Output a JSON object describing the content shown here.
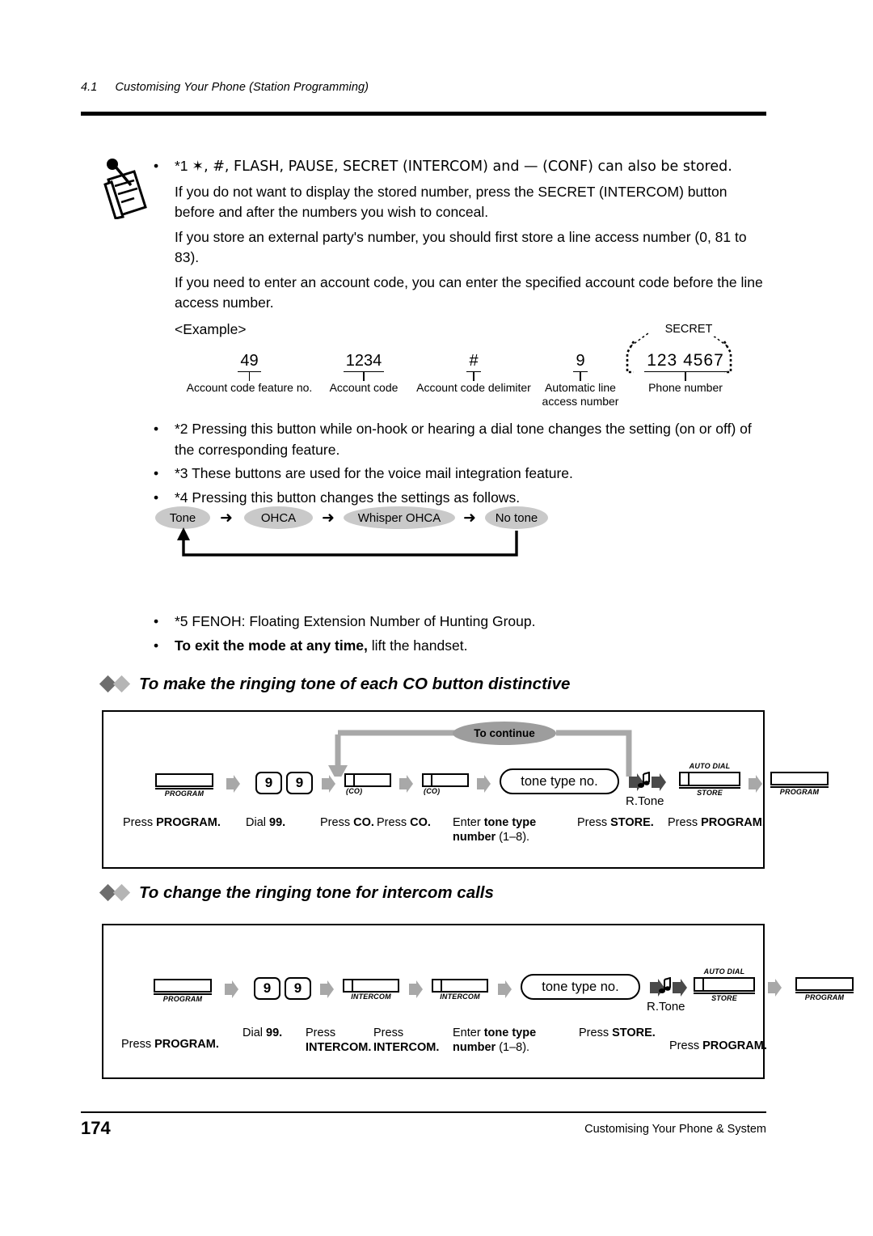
{
  "header": {
    "section_number": "4.1",
    "section_title": "Customising Your Phone (Station Programming)"
  },
  "notes": {
    "icon_name": "notepad-pen-icon",
    "bullet1": {
      "prefix": "*1",
      "text": "✶, #, FLASH, PAUSE, SECRET (INTERCOM) and — (CONF) can also be stored."
    },
    "para1": "If you do not want to display the stored number, press the SECRET (INTERCOM) button before and after the numbers you wish to conceal.",
    "para2": "If you store an external party's number, you should first store a line access number (0, 81 to 83).",
    "para3": "If you need to enter an account code, you can enter the specified account code before the line access number.",
    "example_label": "<Example>",
    "bullet2": "*2 Pressing this button while on-hook or hearing a dial tone changes the setting (on or off) of the corresponding feature.",
    "bullet3": "*3 These buttons are used for the voice mail integration feature.",
    "bullet4": "*4 Pressing this button changes the settings as follows.",
    "bullet5": "*5 FENOH: Floating Extension Number of Hunting Group.",
    "bullet6_bold": "To exit the mode at any time,",
    "bullet6_rest": " lift the handset."
  },
  "example_diagram": {
    "secret_label": "SECRET",
    "items": [
      {
        "value": "49",
        "caption": "Account code feature no."
      },
      {
        "value": "1234",
        "caption": "Account code"
      },
      {
        "value": "#",
        "caption": "Account code delimiter"
      },
      {
        "value": "9",
        "caption": "Automatic line access number"
      },
      {
        "value": "123  4567",
        "caption": "Phone number"
      }
    ]
  },
  "tone_flow": {
    "states": [
      "Tone",
      "OHCA",
      "Whisper OHCA",
      "No tone"
    ],
    "arrow": "➜",
    "loops_back_to": "Tone"
  },
  "sections": [
    {
      "heading": "To make the ringing tone of each CO button distinctive",
      "continue_label": "To continue",
      "rtone_label": "R.Tone",
      "steps": [
        {
          "key_type": "program",
          "key_label": "PROGRAM",
          "caption_plain": "Press ",
          "caption_bold": "PROGRAM.",
          "caption_tail": ""
        },
        {
          "key_type": "digits",
          "digits": [
            "9",
            "9"
          ],
          "caption_plain": "Dial ",
          "caption_bold": "99.",
          "caption_tail": ""
        },
        {
          "key_type": "co",
          "key_label": "(CO)",
          "caption_plain": "Press ",
          "caption_bold": "CO.",
          "caption_tail": ""
        },
        {
          "key_type": "co",
          "key_label": "(CO)",
          "caption_plain": "Press ",
          "caption_bold": "CO.",
          "caption_tail": ""
        },
        {
          "key_type": "pill",
          "key_label": "tone type no.",
          "caption_plain": "Enter ",
          "caption_bold": "tone type number",
          "caption_tail": " (1–8)."
        },
        {
          "key_type": "tone",
          "key_label": "R.Tone",
          "caption_plain": "",
          "caption_bold": "",
          "caption_tail": ""
        },
        {
          "key_type": "autodial",
          "key_label_above": "AUTO DIAL",
          "key_label_below": "STORE",
          "caption_plain": "Press ",
          "caption_bold": "STORE.",
          "caption_tail": ""
        },
        {
          "key_type": "program",
          "key_label": "PROGRAM",
          "caption_plain": "Press ",
          "caption_bold": "PROGRAM.",
          "caption_tail": ""
        }
      ]
    },
    {
      "heading": "To change the ringing tone for intercom calls",
      "continue_label": "",
      "rtone_label": "R.Tone",
      "steps": [
        {
          "key_type": "program",
          "key_label": "PROGRAM",
          "caption_plain": "Press ",
          "caption_bold": "PROGRAM.",
          "caption_tail": ""
        },
        {
          "key_type": "digits",
          "digits": [
            "9",
            "9"
          ],
          "caption_plain": "Dial ",
          "caption_bold": "99.",
          "caption_tail": ""
        },
        {
          "key_type": "intercom",
          "key_label": "INTERCOM",
          "caption_plain": "Press ",
          "caption_bold": "INTERCOM.",
          "caption_tail": ""
        },
        {
          "key_type": "intercom",
          "key_label": "INTERCOM",
          "caption_plain": "Press ",
          "caption_bold": "INTERCOM.",
          "caption_tail": ""
        },
        {
          "key_type": "pill",
          "key_label": "tone type no.",
          "caption_plain": "Enter ",
          "caption_bold": "tone type number",
          "caption_tail": " (1–8)."
        },
        {
          "key_type": "tone",
          "key_label": "R.Tone",
          "caption_plain": "",
          "caption_bold": "",
          "caption_tail": ""
        },
        {
          "key_type": "autodial",
          "key_label_above": "AUTO DIAL",
          "key_label_below": "STORE",
          "caption_plain": "Press ",
          "caption_bold": "STORE.",
          "caption_tail": ""
        },
        {
          "key_type": "program",
          "key_label": "PROGRAM",
          "caption_plain": "Press ",
          "caption_bold": "PROGRAM.",
          "caption_tail": ""
        }
      ]
    }
  ],
  "footer": {
    "page_number": "174",
    "text": "Customising Your Phone & System"
  },
  "colors": {
    "ink": "#000000",
    "oval_gray": "#c9c9c9",
    "continue_gray": "#9d9d9d",
    "arrow_gray": "#a8a8a8",
    "diamond_dark": "#6e6e6e",
    "diamond_light": "#b5b5b5"
  }
}
